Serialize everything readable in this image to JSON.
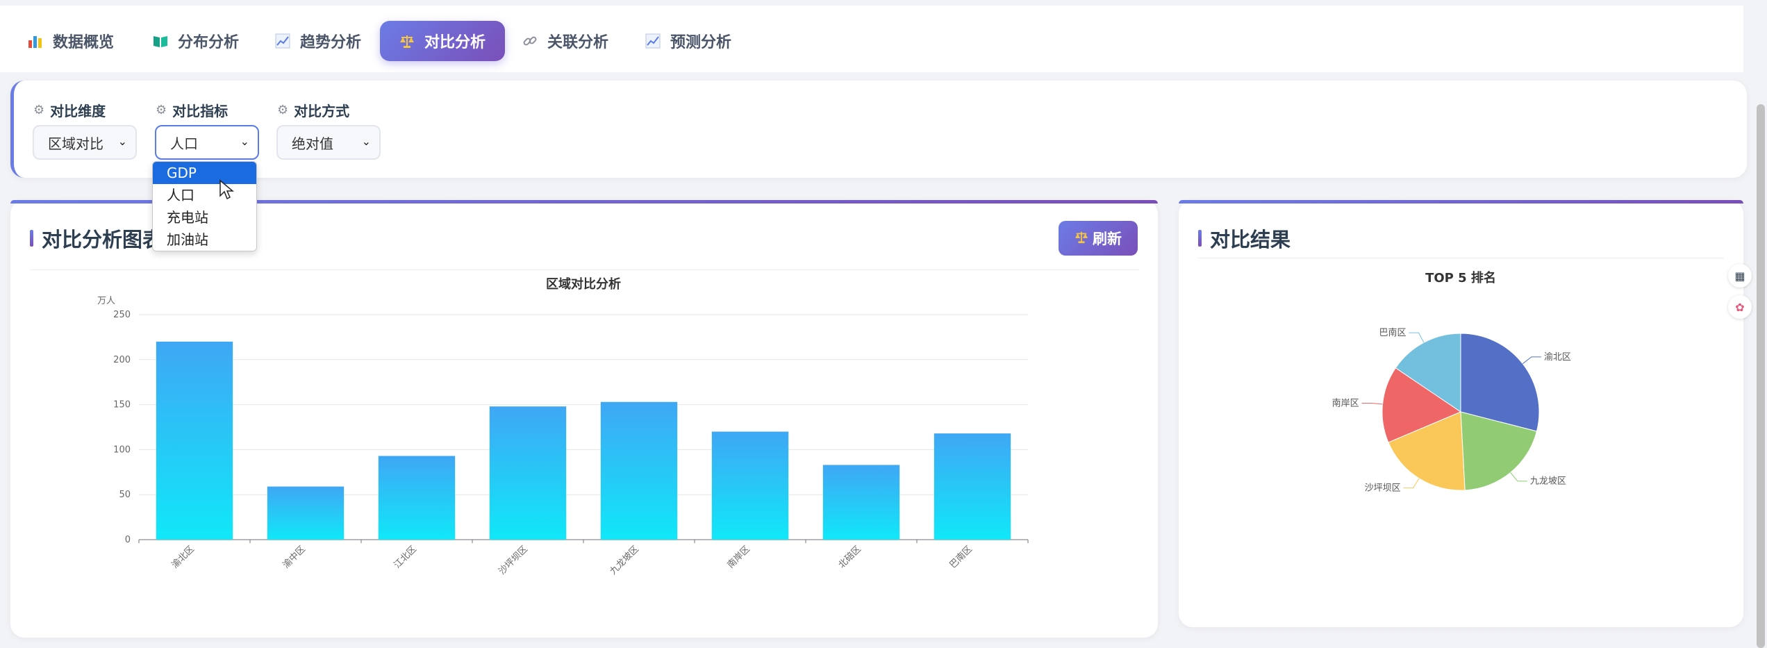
{
  "tabs": [
    {
      "label": "数据概览",
      "icon": "bar-chart-icon"
    },
    {
      "label": "分布分析",
      "icon": "book-icon"
    },
    {
      "label": "趋势分析",
      "icon": "trend-icon"
    },
    {
      "label": "对比分析",
      "icon": "scale-icon",
      "active": true
    },
    {
      "label": "关联分析",
      "icon": "link-icon"
    },
    {
      "label": "预测分析",
      "icon": "trend-icon"
    }
  ],
  "controls": {
    "dimension_label": "对比维度",
    "dimension_value": "区域对比",
    "metric_label": "对比指标",
    "metric_value": "人口",
    "method_label": "对比方式",
    "method_value": "绝对值",
    "metric_options": [
      "GDP",
      "人口",
      "充电站",
      "加油站"
    ],
    "metric_highlighted": "GDP"
  },
  "chart_panel": {
    "title": "对比分析图表",
    "refresh_label": "刷新"
  },
  "result_panel": {
    "title": "对比结果"
  },
  "colors": {
    "accent_start": "#6c7ce6",
    "accent_end": "#7a4fb8",
    "bar_top": "#3fa7f5",
    "bar_bottom": "#10e8f8"
  },
  "chart_data": [
    {
      "type": "bar",
      "title": "区域对比分析",
      "ylabel": "万人",
      "categories": [
        "渝北区",
        "渝中区",
        "江北区",
        "沙坪坝区",
        "九龙坡区",
        "南岸区",
        "北碚区",
        "巴南区"
      ],
      "values": [
        220,
        59,
        93,
        148,
        153,
        120,
        83,
        118
      ],
      "ylim": [
        0,
        250
      ],
      "yticks": [
        0,
        50,
        100,
        150,
        200,
        250
      ],
      "grid": true
    },
    {
      "type": "pie",
      "title": "TOP 5 排名",
      "slices": [
        {
          "label": "渝北区",
          "value": 220,
          "color": "#5470c6"
        },
        {
          "label": "九龙坡区",
          "value": 153,
          "color": "#91cc75"
        },
        {
          "label": "沙坪坝区",
          "value": 148,
          "color": "#fac858"
        },
        {
          "label": "南岸区",
          "value": 120,
          "color": "#ee6666"
        },
        {
          "label": "巴南区",
          "value": 118,
          "color": "#73c0de"
        }
      ]
    }
  ]
}
